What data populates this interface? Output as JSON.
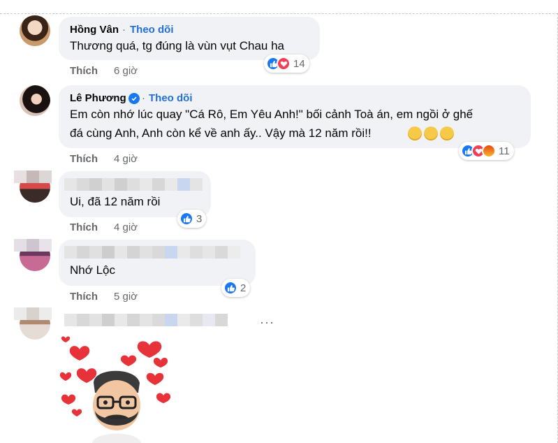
{
  "comments": [
    {
      "author": "Hồng Vân",
      "follow": "Theo dõi",
      "separator": "·",
      "text_lines": [
        "Thương quá, tg đúng là vùn vụt Chau ha"
      ],
      "like_label": "Thích",
      "time": "6 giờ",
      "reactions": [
        "like-icon",
        "love-icon"
      ],
      "reaction_count": "14"
    },
    {
      "author": "Lê Phương",
      "verified": true,
      "follow": "Theo dõi",
      "text_lines": [
        "Em còn nhớ lúc quay \"Cá Rô, Em Yêu Anh!\" bối cảnh Toà án, em ngồi ở ghế",
        "đá cùng Anh, Anh còn kể về anh ấy.. Vậy mà 12 năm rồi!!"
      ],
      "like_label": "Thích",
      "time": "4 giờ",
      "reactions": [
        "like-icon",
        "love-icon",
        "angry-icon"
      ],
      "reaction_count": "11"
    },
    {
      "author_blurred": true,
      "text_lines": [
        "Ui, đã 12 năm rồi"
      ],
      "like_label": "Thích",
      "time": "4 giờ",
      "reactions": [
        "like-icon"
      ],
      "reaction_count": "3"
    },
    {
      "author_blurred": true,
      "text_lines": [
        "Nhớ Lộc"
      ],
      "like_label": "Thích",
      "time": "5 giờ",
      "reactions": [
        "like-icon"
      ],
      "reaction_count": "2"
    },
    {
      "author_blurred": true,
      "sticker": "avatar-hearts-sticker",
      "more_label": "···"
    }
  ],
  "colors": {
    "bubble": "#f0f2f5",
    "link": "#216fdb",
    "muted": "#65676b",
    "like": "#1877f2",
    "love": "#f33e58",
    "angry": "#e9710f"
  }
}
